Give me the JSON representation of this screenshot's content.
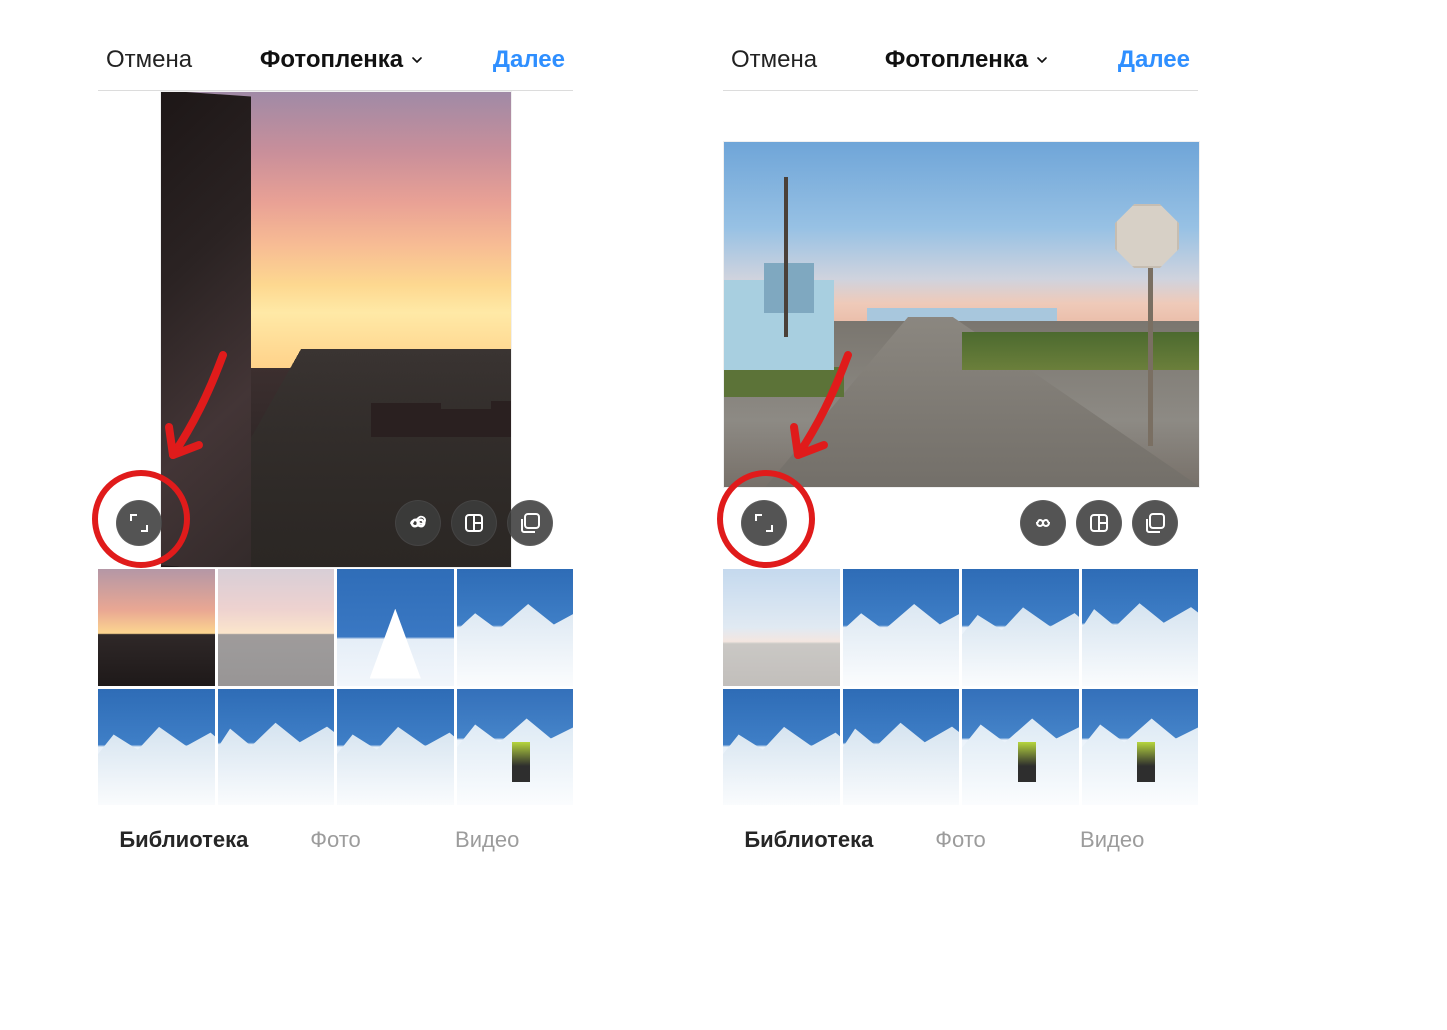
{
  "colors": {
    "accent": "#2f8fff",
    "annotation": "#e01b1b",
    "overlay_button": "rgba(60,60,60,.88)"
  },
  "icons": {
    "expand": "expand-crop-icon",
    "boomerang": "infinity-icon",
    "layout": "layout-grid-icon",
    "multi": "multi-select-icon",
    "chevron": "chevron-down-icon"
  },
  "left": {
    "header": {
      "cancel": "Отмена",
      "title": "Фотопленка",
      "next": "Далее"
    },
    "preview": {
      "aspect": "portrait",
      "subject": "sunset-cityscape"
    },
    "grid": [
      {
        "id": "sunset-1",
        "kind": "sunset",
        "selected": false
      },
      {
        "id": "sunset-2",
        "kind": "sunset2",
        "selected": true
      },
      {
        "id": "peak",
        "kind": "peak",
        "selected": false
      },
      {
        "id": "snow-a",
        "kind": "snow1",
        "selected": false
      },
      {
        "id": "snow-b",
        "kind": "snow2",
        "selected": false
      },
      {
        "id": "snow-c",
        "kind": "snow3",
        "selected": false
      },
      {
        "id": "snow-d",
        "kind": "snow2",
        "selected": false
      },
      {
        "id": "ski",
        "kind": "ski",
        "selected": false
      }
    ],
    "tabs": {
      "library": "Библиотека",
      "photo": "Фото",
      "video": "Видео",
      "active": "library"
    },
    "annotation": {
      "target": "expand-crop-button"
    }
  },
  "right": {
    "header": {
      "cancel": "Отмена",
      "title": "Фотопленка",
      "next": "Далее"
    },
    "preview": {
      "aspect": "landscape",
      "subject": "coastal-street"
    },
    "grid": [
      {
        "id": "street-sm",
        "kind": "street-sm",
        "selected": true
      },
      {
        "id": "snow-a",
        "kind": "snow1",
        "selected": false
      },
      {
        "id": "snow-b",
        "kind": "snow2",
        "selected": false
      },
      {
        "id": "snow-c",
        "kind": "snow3",
        "selected": false
      },
      {
        "id": "snow-d",
        "kind": "snow2",
        "selected": false
      },
      {
        "id": "snow-e",
        "kind": "snow3",
        "selected": false
      },
      {
        "id": "ski-1",
        "kind": "ski",
        "selected": false
      },
      {
        "id": "ski-2",
        "kind": "ski",
        "selected": false
      }
    ],
    "tabs": {
      "library": "Библиотека",
      "photo": "Фото",
      "video": "Видео",
      "active": "library"
    },
    "annotation": {
      "target": "expand-crop-button"
    }
  }
}
